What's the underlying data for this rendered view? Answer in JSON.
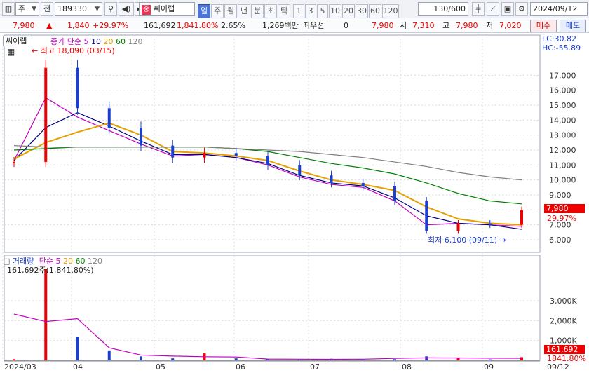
{
  "toolbar": {
    "market_label": "주",
    "jeon_label": "전",
    "code": "189330",
    "search_icon": "magnifier-icon",
    "stock_type": "중",
    "stock_name": "씨이랩",
    "periods": [
      "일",
      "주",
      "월",
      "년",
      "분",
      "초",
      "틱"
    ],
    "active_period": "일",
    "minutes": [
      "1",
      "3",
      "5",
      "10",
      "20",
      "30",
      "60",
      "120"
    ],
    "count": "130/600",
    "date": "2024/09/12"
  },
  "quote": {
    "price": "7,980",
    "change": "1,840",
    "change_pct": "+29.97%",
    "volume": "161,692",
    "volume_pct": "1,841.80%",
    "turnover": "2.65%",
    "amount": "1,269백만",
    "hoga_label": "최우선",
    "hoga_value": "0",
    "ask": "7,980",
    "open_label": "시",
    "open": "7,310",
    "high_label": "고",
    "high": "7,980",
    "low_label": "저",
    "low": "7,020",
    "buy_label": "매수",
    "sell_label": "매도"
  },
  "price_chart": {
    "name_tag": "씨이랩",
    "legend_label": "종가 단순",
    "ma_periods": [
      "5",
      "10",
      "20",
      "60",
      "120"
    ],
    "ma_colors": [
      "#c000c0",
      "#000080",
      "#e6a000",
      "#008000",
      "#808080"
    ],
    "lc": "LC:30.82",
    "hc": "HC:-55.89",
    "high_note": "최고 18,090 (03/15)",
    "low_note": "최저 6,100 (09/11)",
    "current_price_tag": "7,980",
    "current_pct_tag": "29.97%",
    "y_ticks": [
      "17,000",
      "16,000",
      "15,000",
      "14,000",
      "13,000",
      "12,000",
      "11,000",
      "10,000",
      "9,000",
      "8,000",
      "7,000",
      "6,000"
    ]
  },
  "volume_chart": {
    "legend_title": "거래량",
    "legend_label": "단순",
    "ma_periods": [
      "5",
      "20",
      "60",
      "120"
    ],
    "current_text": "161,692주(1,841.80%)",
    "y_ticks": [
      "3,000K",
      "2,000K",
      "1,000K"
    ],
    "current_tag": "161,692",
    "current_pct_tag": "1841.80%"
  },
  "x_axis": [
    "2024/03",
    "04",
    "05",
    "06",
    "07",
    "08",
    "09",
    "09/12"
  ],
  "chart_data": {
    "type": "candlestick",
    "title": "씨이랩",
    "period": "daily",
    "x": [
      "2024-03",
      "04",
      "05",
      "06",
      "07",
      "08",
      "09"
    ],
    "ylim": [
      6000,
      18000
    ],
    "series": [
      {
        "name": "종가",
        "values": [
          11200,
          17500,
          14800,
          13500,
          12300,
          11500,
          11800,
          11600,
          11000,
          10300,
          9800,
          9600,
          8600,
          6600,
          7100,
          7000,
          7980
        ]
      },
      {
        "name": "단순 5",
        "values": [
          11300,
          15500,
          14200,
          13300,
          12400,
          11600,
          11700,
          11500,
          11000,
          10200,
          9700,
          9500,
          8600,
          7000,
          7100,
          7000,
          6900
        ]
      },
      {
        "name": "단순 10",
        "values": [
          11300,
          13500,
          14500,
          13600,
          12600,
          11700,
          11700,
          11500,
          11100,
          10300,
          9800,
          9600,
          8800,
          7600,
          7100,
          7000,
          6700
        ]
      },
      {
        "name": "단순 20",
        "values": [
          11400,
          12500,
          13200,
          13800,
          13000,
          11900,
          11800,
          11600,
          11300,
          10600,
          10000,
          9700,
          9300,
          8200,
          7400,
          7100,
          7000
        ]
      },
      {
        "name": "단순 60",
        "values": [
          12000,
          12100,
          12200,
          12200,
          12200,
          12200,
          12200,
          12100,
          11900,
          11500,
          11100,
          10800,
          10400,
          9800,
          9100,
          8600,
          8400
        ]
      },
      {
        "name": "단순 120",
        "values": [
          12300,
          12200,
          12200,
          12200,
          12200,
          12200,
          12200,
          12100,
          12000,
          11900,
          11700,
          11500,
          11200,
          10900,
          10500,
          10200,
          10000
        ]
      }
    ],
    "volume": {
      "name": "거래량",
      "values": [
        60,
        4600,
        1200,
        500,
        200,
        100,
        350,
        100,
        60,
        40,
        80,
        40,
        60,
        200,
        120,
        50,
        162
      ],
      "unit": "K"
    }
  }
}
